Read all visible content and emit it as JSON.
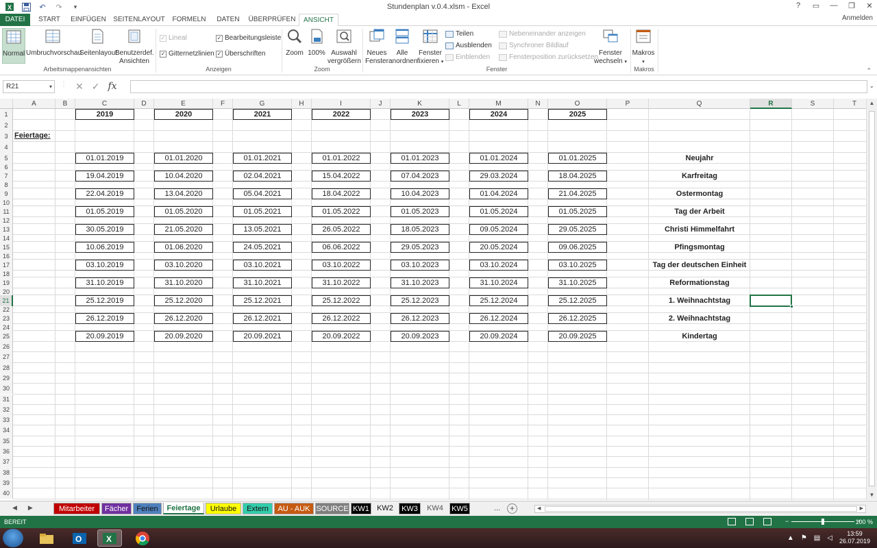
{
  "window": {
    "title": "Stundenplan v.0.4.xlsm - Excel",
    "controls": [
      "?",
      "▭",
      "—",
      "❐",
      "✕"
    ],
    "sign_in": "Anmelden"
  },
  "quick_access": {
    "save_icon": "save-icon",
    "undo_icon": "undo-icon",
    "redo_icon": "redo-icon",
    "customize": "▾"
  },
  "ribbon_tabs": [
    "DATEI",
    "START",
    "EINFÜGEN",
    "SEITENLAYOUT",
    "FORMELN",
    "DATEN",
    "ÜBERPRÜFEN",
    "ANSICHT"
  ],
  "active_tab": "ANSICHT",
  "ribbon": {
    "workbook_views": {
      "label": "Arbeitsmappenansichten",
      "normal": "Normal",
      "page_break": "Umbruchvorschau",
      "page_layout": "Seitenlayout",
      "custom_views_1": "Benutzerdef.",
      "custom_views_2": "Ansichten"
    },
    "show": {
      "label": "Anzeigen",
      "ruler": "Lineal",
      "formula_bar": "Bearbeitungsleiste",
      "gridlines": "Gitternetzlinien",
      "headings": "Überschriften"
    },
    "zoom": {
      "label": "Zoom",
      "zoom": "Zoom",
      "hundred": "100%",
      "selection_1": "Auswahl",
      "selection_2": "vergrößern"
    },
    "window_group": {
      "label": "Fenster",
      "new_1": "Neues",
      "new_2": "Fenster",
      "arrange_1": "Alle",
      "arrange_2": "anordnen",
      "freeze_1": "Fenster",
      "freeze_2": "fixieren",
      "split": "Teilen",
      "hide": "Ausblenden",
      "unhide": "Einblenden",
      "side_by_side": "Nebeneinander anzeigen",
      "sync_scroll": "Synchroner Bildlauf",
      "reset_pos": "Fensterposition zurücksetzen",
      "switch_1": "Fenster",
      "switch_2": "wechseln"
    },
    "macros": {
      "label": "Makros",
      "button": "Makros"
    }
  },
  "formula_bar": {
    "name_box": "R21",
    "formula": ""
  },
  "columns": [
    "A",
    "B",
    "C",
    "D",
    "E",
    "F",
    "G",
    "H",
    "I",
    "J",
    "K",
    "L",
    "M",
    "N",
    "O",
    "P",
    "Q",
    "R",
    "S",
    "T"
  ],
  "selected_column": "R",
  "selected_row": 21,
  "rows": [
    1,
    2,
    3,
    4,
    5,
    6,
    7,
    8,
    9,
    10,
    11,
    12,
    13,
    14,
    15,
    16,
    17,
    18,
    19,
    20,
    21,
    22,
    23,
    24,
    25,
    26,
    27,
    28,
    29,
    30,
    31,
    32,
    33,
    34,
    35,
    36,
    37,
    38,
    39,
    40
  ],
  "sheet": {
    "section_label": "Feiertage:",
    "years": [
      "2019",
      "2020",
      "2021",
      "2022",
      "2023",
      "2024",
      "2025"
    ],
    "holidays": [
      {
        "name": "Neujahr",
        "dates": [
          "01.01.2019",
          "01.01.2020",
          "01.01.2021",
          "01.01.2022",
          "01.01.2023",
          "01.01.2024",
          "01.01.2025"
        ]
      },
      {
        "name": "Karfreitag",
        "dates": [
          "19.04.2019",
          "10.04.2020",
          "02.04.2021",
          "15.04.2022",
          "07.04.2023",
          "29.03.2024",
          "18.04.2025"
        ]
      },
      {
        "name": "Ostermontag",
        "dates": [
          "22.04.2019",
          "13.04.2020",
          "05.04.2021",
          "18.04.2022",
          "10.04.2023",
          "01.04.2024",
          "21.04.2025"
        ]
      },
      {
        "name": "Tag der Arbeit",
        "dates": [
          "01.05.2019",
          "01.05.2020",
          "01.05.2021",
          "01.05.2022",
          "01.05.2023",
          "01.05.2024",
          "01.05.2025"
        ]
      },
      {
        "name": "Christi Himmelfahrt",
        "dates": [
          "30.05.2019",
          "21.05.2020",
          "13.05.2021",
          "26.05.2022",
          "18.05.2023",
          "09.05.2024",
          "29.05.2025"
        ]
      },
      {
        "name": "Pfingsmontag",
        "dates": [
          "10.06.2019",
          "01.06.2020",
          "24.05.2021",
          "06.06.2022",
          "29.05.2023",
          "20.05.2024",
          "09.06.2025"
        ]
      },
      {
        "name": "Tag der deutschen Einheit",
        "dates": [
          "03.10.2019",
          "03.10.2020",
          "03.10.2021",
          "03.10.2022",
          "03.10.2023",
          "03.10.2024",
          "03.10.2025"
        ]
      },
      {
        "name": "Reformationstag",
        "dates": [
          "31.10.2019",
          "31.10.2020",
          "31.10.2021",
          "31.10.2022",
          "31.10.2023",
          "31.10.2024",
          "31.10.2025"
        ]
      },
      {
        "name": "1. Weihnachtstag",
        "dates": [
          "25.12.2019",
          "25.12.2020",
          "25.12.2021",
          "25.12.2022",
          "25.12.2023",
          "25.12.2024",
          "25.12.2025"
        ]
      },
      {
        "name": "2. Weihnachtstag",
        "dates": [
          "26.12.2019",
          "26.12.2020",
          "26.12.2021",
          "26.12.2022",
          "26.12.2023",
          "26.12.2024",
          "26.12.2025"
        ]
      },
      {
        "name": "Kindertag",
        "dates": [
          "20.09.2019",
          "20.09.2020",
          "20.09.2021",
          "20.09.2022",
          "20.09.2023",
          "20.09.2024",
          "20.09.2025"
        ]
      }
    ]
  },
  "sheet_tabs": [
    {
      "name": "Mitarbeiter",
      "bg": "#c00000",
      "fg": "#ffffff"
    },
    {
      "name": "Fächer",
      "bg": "#7030a0",
      "fg": "#ffffff"
    },
    {
      "name": "Ferien",
      "bg": "#4f81bd",
      "fg": "#111111"
    },
    {
      "name": "Feiertage",
      "bg": "#ffffff",
      "fg": "#217346",
      "active": true
    },
    {
      "name": "Urlaube",
      "bg": "#ffff00",
      "fg": "#111111"
    },
    {
      "name": "Extern",
      "bg": "#33ccaa",
      "fg": "#111111"
    },
    {
      "name": "AU - AUK",
      "bg": "#c55a11",
      "fg": "#ffffff"
    },
    {
      "name": "SOURCE",
      "bg": "#7f7f7f",
      "fg": "#ffffff"
    },
    {
      "name": "KW1",
      "bg": "#000000",
      "fg": "#ffffff"
    },
    {
      "name": "KW2",
      "bg": "#f0f0f0",
      "fg": "#111111"
    },
    {
      "name": "KW3",
      "bg": "#000000",
      "fg": "#ffffff"
    },
    {
      "name": "KW4",
      "bg": "#f0f0f0",
      "fg": "#555555"
    },
    {
      "name": "KW5",
      "bg": "#000000",
      "fg": "#ffffff"
    }
  ],
  "sheet_more": "...",
  "status": {
    "ready": "BEREIT",
    "zoom": "100 %"
  },
  "taskbar": {
    "time": "13:59",
    "date": "26.07.2019",
    "apps": [
      "explorer-icon",
      "outlook-icon",
      "excel-icon",
      "chrome-icon"
    ]
  },
  "colors": {
    "accent": "#217346"
  }
}
